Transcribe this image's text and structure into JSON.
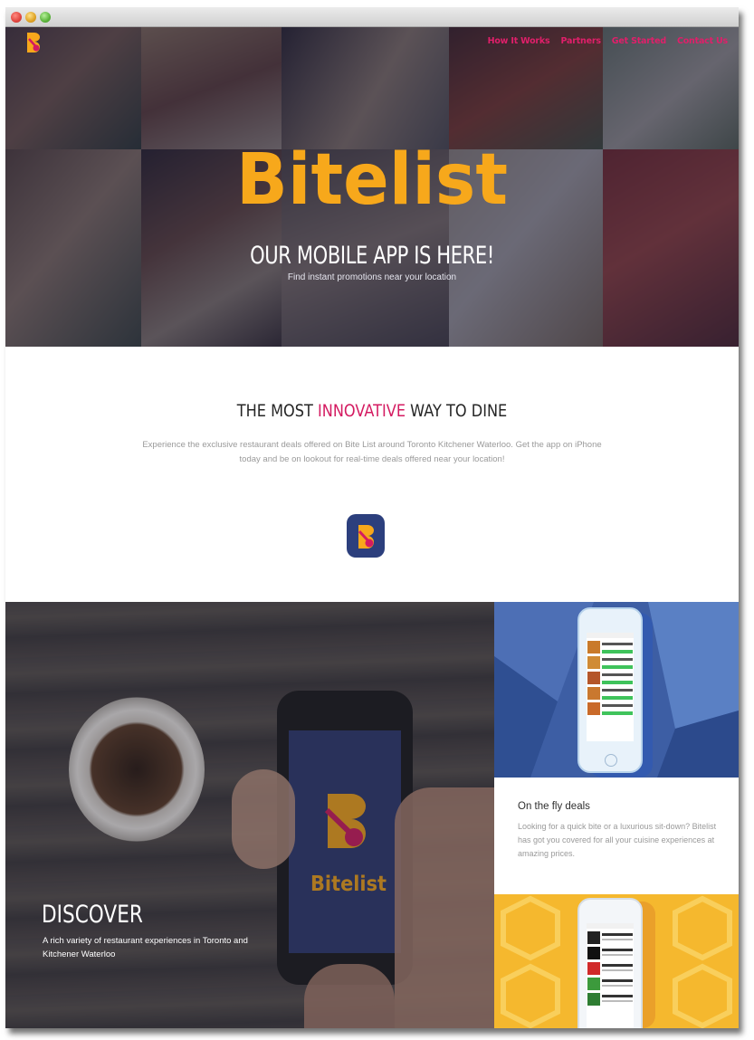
{
  "nav": {
    "items": [
      {
        "label": "How It Works"
      },
      {
        "label": "Partners"
      },
      {
        "label": "Get Started"
      },
      {
        "label": "Contact Us"
      }
    ]
  },
  "hero": {
    "brand_logo_text": "Bitelist",
    "title": "OUR MOBILE APP IS HERE!",
    "subtitle": "Find instant promotions near your location"
  },
  "intro": {
    "title_prefix": "THE MOST ",
    "title_highlight": "INNOVATIVE",
    "title_suffix": " WAY TO DINE",
    "text": "Experience the exclusive restaurant deals offered on Bite List around Toronto Kitchener Waterloo. Get the app on iPhone today and be on lookout for real-time deals offered near your location!"
  },
  "discover": {
    "phone_logo_text": "Bitelist",
    "title": "DISCOVER",
    "text": "A rich variety of restaurant experiences in Toronto and Kitchener Waterloo"
  },
  "deals": {
    "title": "On the fly deals",
    "text": "Looking for a quick bite or a luxurious sit-down? Bitelist has got you covered for all your cuisine experiences at amazing prices."
  },
  "colors": {
    "brand_yellow": "#f7a81b",
    "accent_pink": "#d41b61",
    "navy": "#2c3f7d",
    "deal_green": "#3fc35b"
  }
}
